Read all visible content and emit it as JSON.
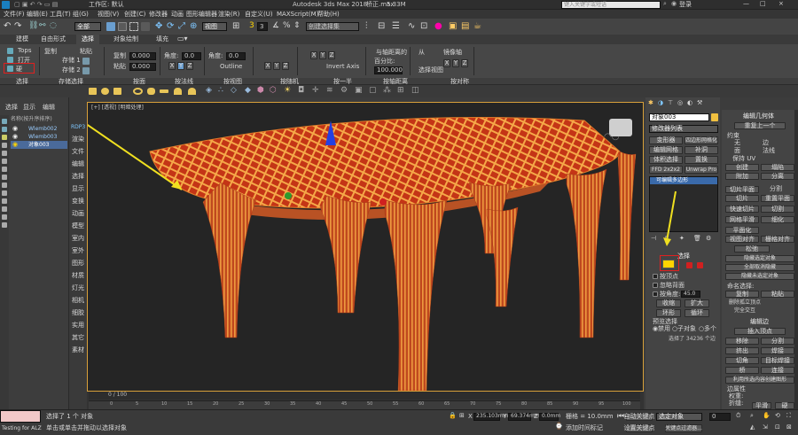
{
  "titlebar": {
    "workspace_label": "工作区: 默认",
    "app_title": "Autodesk 3ds Max 2018",
    "file_name": "桥正.max",
    "file_size": "5.33M",
    "search_placeholder": "键入关键字或短语",
    "login": "登录",
    "win_min": "—",
    "win_max": "□",
    "win_close": "×"
  },
  "menu": [
    "文件(F)",
    "编辑(E)",
    "工具(T)",
    "组(G)",
    "视图(V)",
    "创建(C)",
    "修改器",
    "动画",
    "图形编辑器",
    "渲染(R)",
    "自定义(U)",
    "MAXScript(M)",
    "帮助(H)"
  ],
  "quickbar": {
    "selection_filter": "全部",
    "view_mode": "视图",
    "snap_value": "3",
    "named_set": "创建选择集"
  },
  "ribbon_tabs": [
    "建模",
    "自由形式",
    "选择",
    "对象绘制",
    "填充"
  ],
  "ribbon": {
    "tops": "Tops",
    "open": "打开",
    "hard": "硬",
    "copy": "复制",
    "paste": "粘贴",
    "store1": "存储 1",
    "store2": "存储 2",
    "recall1": "0.000",
    "recall2": "0.000",
    "angle_label": "角度:",
    "angle_value": "0.0",
    "angle2_label": "角度:",
    "angle2_value": "0.0",
    "outline": "Outline",
    "invert_axis": "Invert Axis",
    "percent_label": "百分比:",
    "percent_value": "100.000",
    "from_label": "从",
    "select_view": "选择视图",
    "mirror_axis": "镜像轴",
    "align_dist": "与轴距离的",
    "axes": [
      "X",
      "Y",
      "Z"
    ]
  },
  "ribbon_groups": [
    "选择",
    "存储选择",
    "按面",
    "按法线",
    "按视图",
    "按随机",
    "按一半",
    "按轴距离",
    "按对称"
  ],
  "scene_explorer": {
    "tabs": [
      "选择",
      "显示",
      "编辑"
    ],
    "sort_header": "名称(按升序排序)",
    "items": [
      "Wlemb002",
      "Wlemb003",
      "对象003"
    ]
  },
  "left_strip": [
    "RDP3",
    "渲染",
    "文件",
    "编辑",
    "选择",
    "显示",
    "变换",
    "动画",
    "模型",
    "室内",
    "室外",
    "图形",
    "材质",
    "灯光",
    "相机",
    "细胶",
    "实用",
    "其它",
    "素材"
  ],
  "viewport": {
    "label": "[+] [透视] [明暗处理]"
  },
  "command_panel": {
    "object_name": "对象003",
    "modifier_list": "修改器列表",
    "buttons": [
      "变形器",
      "四边形网格化",
      "编辑网格",
      "补洞",
      "体积选择",
      "置换",
      "FFD 2x2x2",
      "Unwrap Pro"
    ],
    "stack_item": "可编辑多边形",
    "selection_title": "选择",
    "by_vertex": "按顶点",
    "ignore_back": "忽略背面",
    "by_angle": "按角度:",
    "angle_value": "45.0",
    "shrink": "收缩",
    "grow": "扩大",
    "ring": "环形",
    "loop": "循环",
    "preview_title": "预览选择",
    "preview_off": "禁用",
    "preview_sub": "子对象",
    "preview_multi": "多个",
    "selected_count": "选择了 34236 个边"
  },
  "edit_panel": {
    "title": "编辑几何体",
    "repeat_last": "重复上一个",
    "constraints": "约束",
    "none": "无",
    "edge": "边",
    "face": "面",
    "normal": "法线",
    "preserve_uv": "保持 UV",
    "create": "创建",
    "collapse": "塌陷",
    "attach": "附加",
    "detach": "分离",
    "slice_plane": "切片平面",
    "split": "分割",
    "slice": "切片",
    "reset_plane": "重置平面",
    "quickslice": "快速切片",
    "cut": "切割",
    "meshsmooth": "网格平滑",
    "tessellate": "细化",
    "planar": "平面化",
    "view_align": "视图对齐",
    "grid_align": "栅格对齐",
    "relax": "松弛",
    "hide_sel": "隐藏选定对象",
    "unhide_all": "全部取消隐藏",
    "hide_unsel": "隐藏未选定对象",
    "named_sel": "命名选择:",
    "copy": "复制",
    "paste": "粘贴",
    "delete_iso": "删除孤立顶点",
    "full_int": "完全交互",
    "edit_edges": "编辑边",
    "insert_vertex": "插入顶点",
    "remove": "移除",
    "split2": "分割",
    "extrude": "挤出",
    "weld": "焊接",
    "chamfer": "切角",
    "target_weld": "目标焊接",
    "bridge": "桥",
    "connect": "连接",
    "create_shape": "利用所选内容创建图形",
    "edge_props": "边属性",
    "weight": "权重:",
    "crease": "折缝:",
    "smooth": "平滑",
    "hard": "硬"
  },
  "timeline": {
    "counter": "0 / 100",
    "ticks": [
      "0",
      "5",
      "10",
      "15",
      "20",
      "25",
      "30",
      "35",
      "40",
      "45",
      "50",
      "55",
      "60",
      "65",
      "70",
      "75",
      "80",
      "85",
      "90",
      "95",
      "100"
    ]
  },
  "status": {
    "selected": "选择了 1 个 对象",
    "prompt": "单击或单击并拖动以选择对象",
    "script_label": "Testing for ALZ",
    "x": "235.103mm",
    "y": "69.374mm",
    "z": "0.0mm",
    "grid": "栅格 = 10.0mm",
    "add_time_tag": "添加时间标记",
    "autokey": "自动关键点",
    "selected_obj": "选定对象",
    "set_key": "设置关键点",
    "key_filter": "关键点过滤器...",
    "frame": "0"
  },
  "colors": {
    "accent": "#ffd400",
    "highlight": "#e02020",
    "viewport_border": "#d8a03a",
    "model_orange": "#f29a3c",
    "model_red": "#c43516"
  }
}
